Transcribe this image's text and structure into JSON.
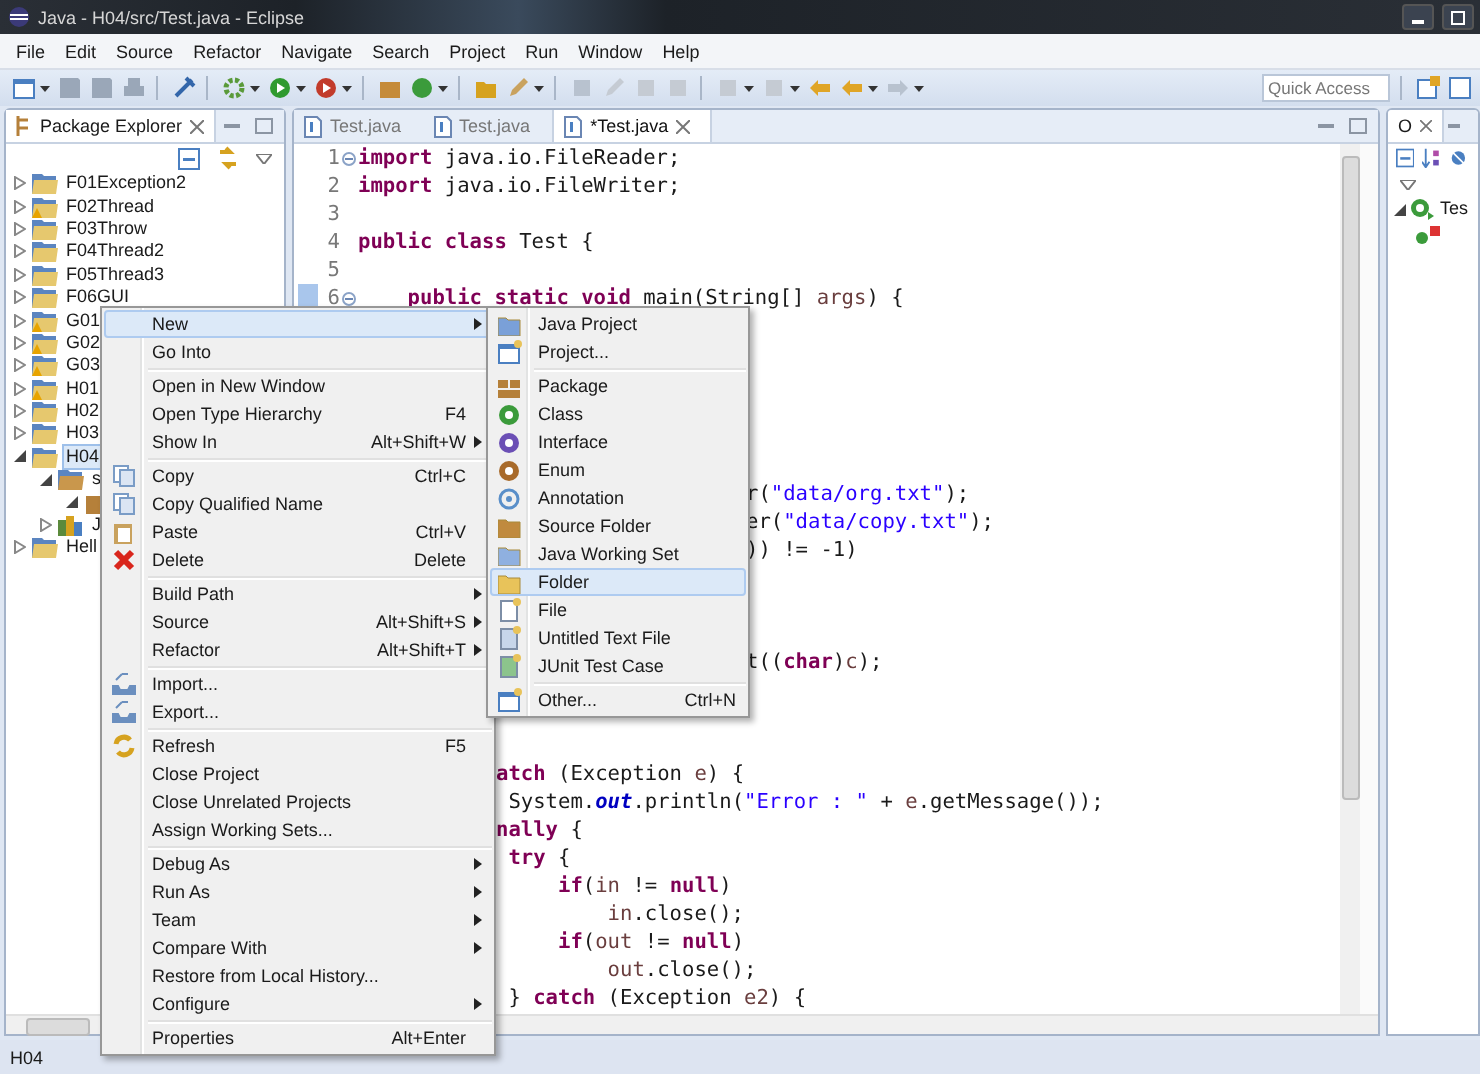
{
  "window": {
    "title": "Java - H04/src/Test.java - Eclipse"
  },
  "menu_bar": [
    "File",
    "Edit",
    "Source",
    "Refactor",
    "Navigate",
    "Search",
    "Project",
    "Run",
    "Window",
    "Help"
  ],
  "quick_access": {
    "placeholder": "Quick Access"
  },
  "package_explorer": {
    "title": "Package Explorer",
    "tree": [
      {
        "label": "F01Exception2",
        "kind": "project",
        "warning": false,
        "expanded": false,
        "selected": false
      },
      {
        "label": "F02Thread",
        "kind": "project",
        "warning": true,
        "expanded": false,
        "selected": false
      },
      {
        "label": "F03Throw",
        "kind": "project",
        "warning": false,
        "expanded": false,
        "selected": false
      },
      {
        "label": "F04Thread2",
        "kind": "project",
        "warning": false,
        "expanded": false,
        "selected": false
      },
      {
        "label": "F05Thread3",
        "kind": "project",
        "warning": false,
        "expanded": false,
        "selected": false
      },
      {
        "label": "F06GUI",
        "kind": "project",
        "warning": false,
        "expanded": false,
        "selected": false
      },
      {
        "label": "G01",
        "kind": "project",
        "warning": true,
        "expanded": false,
        "selected": false
      },
      {
        "label": "G02",
        "kind": "project",
        "warning": true,
        "expanded": false,
        "selected": false
      },
      {
        "label": "G03",
        "kind": "project",
        "warning": true,
        "expanded": false,
        "selected": false
      },
      {
        "label": "H01",
        "kind": "project",
        "warning": true,
        "expanded": false,
        "selected": false
      },
      {
        "label": "H02",
        "kind": "project",
        "warning": false,
        "expanded": false,
        "selected": false
      },
      {
        "label": "H03",
        "kind": "project",
        "warning": false,
        "expanded": false,
        "selected": false
      },
      {
        "label": "H04",
        "kind": "project",
        "warning": false,
        "expanded": true,
        "selected": true,
        "children": [
          {
            "label": "s",
            "kind": "source",
            "warning": false,
            "expanded": true,
            "selected": false,
            "children": [
              {
                "kind": "package",
                "warning": false,
                "expanded": true,
                "selected": false
              }
            ]
          },
          {
            "label": "J",
            "kind": "library",
            "warning": false,
            "expanded": false,
            "selected": false
          }
        ]
      },
      {
        "label": "Hell",
        "kind": "project",
        "warning": false,
        "expanded": false,
        "selected": false
      }
    ]
  },
  "editor": {
    "tabs": [
      {
        "label": "Test.java",
        "selected": false
      },
      {
        "label": "Test.java",
        "selected": false
      },
      {
        "label": "*Test.java",
        "selected": true
      }
    ],
    "lines": [
      {
        "kind": "numbered",
        "number": "1",
        "fold": true,
        "changed": false,
        "tokens": [
          {
            "text": "import",
            "kind": "keyword"
          },
          {
            "text": " java.io.FileReader;",
            "kind": "plain"
          }
        ]
      },
      {
        "kind": "numbered",
        "number": "2",
        "fold": false,
        "changed": false,
        "tokens": [
          {
            "text": "import",
            "kind": "keyword"
          },
          {
            "text": " java.io.FileWriter;",
            "kind": "plain"
          }
        ]
      },
      {
        "kind": "numbered",
        "number": "3",
        "fold": false,
        "changed": false
      },
      {
        "kind": "numbered",
        "number": "4",
        "fold": false,
        "changed": false,
        "tokens": [
          {
            "text": "public",
            "kind": "keyword"
          },
          {
            "text": " class",
            "kind": "keyword"
          },
          {
            "text": " Test {",
            "kind": "plain"
          }
        ]
      },
      {
        "kind": "numbered",
        "number": "5",
        "fold": false,
        "changed": false
      },
      {
        "kind": "numbered",
        "number": "6",
        "fold": true,
        "changed": true,
        "tokens": [
          {
            "text": "    public",
            "kind": "keyword"
          },
          {
            "text": " static",
            "kind": "keyword"
          },
          {
            "text": " void",
            "kind": "keyword"
          },
          {
            "text": " main(String[] ",
            "kind": "plain"
          },
          {
            "text": "args",
            "kind": "variable"
          },
          {
            "text": ") {",
            "kind": "plain"
          }
        ]
      },
      {
        "kind": "under-submenu",
        "tokens": [
          {
            "text": "r(",
            "kind": "plain"
          },
          {
            "text": "\"data/org.txt\"",
            "kind": "string"
          },
          {
            "text": ");",
            "kind": "plain"
          }
        ]
      },
      {
        "kind": "under-submenu",
        "tokens": [
          {
            "text": "er(",
            "kind": "plain"
          },
          {
            "text": "\"data/copy.txt\"",
            "kind": "string"
          },
          {
            "text": ");",
            "kind": "plain"
          }
        ]
      },
      {
        "kind": "under-submenu",
        "tokens": [
          {
            "text": ")) != -1)",
            "kind": "plain"
          }
        ]
      },
      {
        "kind": "under-submenu",
        "tokens": [
          {
            "text": "t((",
            "kind": "plain"
          },
          {
            "text": "char",
            "kind": "keyword"
          },
          {
            "text": ")",
            "kind": "plain"
          },
          {
            "text": "c",
            "kind": "variable"
          },
          {
            "text": ");",
            "kind": "plain"
          }
        ]
      },
      {
        "kind": "under-menu",
        "tokens": [
          {
            "text": "atch",
            "kind": "keyword"
          },
          {
            "text": " (Exception ",
            "kind": "plain"
          },
          {
            "text": "e",
            "kind": "variable"
          },
          {
            "text": ") {",
            "kind": "plain"
          }
        ]
      },
      {
        "kind": "under-menu",
        "tokens": [
          {
            "text": " System.",
            "kind": "plain"
          },
          {
            "text": "out",
            "kind": "field"
          },
          {
            "text": ".println(",
            "kind": "plain"
          },
          {
            "text": "\"Error : \"",
            "kind": "string"
          },
          {
            "text": " + ",
            "kind": "plain"
          },
          {
            "text": "e",
            "kind": "variable"
          },
          {
            "text": ".getMessage());",
            "kind": "plain"
          }
        ]
      },
      {
        "kind": "under-menu",
        "tokens": [
          {
            "text": "nally",
            "kind": "keyword"
          },
          {
            "text": " {",
            "kind": "plain"
          }
        ]
      },
      {
        "kind": "under-menu",
        "tokens": [
          {
            "text": " try",
            "kind": "keyword"
          },
          {
            "text": " {",
            "kind": "plain"
          }
        ]
      },
      {
        "kind": "under-menu",
        "tokens": [
          {
            "text": "     if",
            "kind": "keyword"
          },
          {
            "text": "(",
            "kind": "plain"
          },
          {
            "text": "in",
            "kind": "variable"
          },
          {
            "text": " != ",
            "kind": "plain"
          },
          {
            "text": "null",
            "kind": "keyword"
          },
          {
            "text": ")",
            "kind": "plain"
          }
        ]
      },
      {
        "kind": "under-menu",
        "tokens": [
          {
            "text": "         in",
            "kind": "variable"
          },
          {
            "text": ".close();",
            "kind": "plain"
          }
        ]
      },
      {
        "kind": "under-menu",
        "tokens": [
          {
            "text": "     if",
            "kind": "keyword"
          },
          {
            "text": "(",
            "kind": "plain"
          },
          {
            "text": "out",
            "kind": "variable"
          },
          {
            "text": " != ",
            "kind": "plain"
          },
          {
            "text": "null",
            "kind": "keyword"
          },
          {
            "text": ")",
            "kind": "plain"
          }
        ]
      },
      {
        "kind": "under-menu",
        "tokens": [
          {
            "text": "         out",
            "kind": "variable"
          },
          {
            "text": ".close();",
            "kind": "plain"
          }
        ]
      },
      {
        "kind": "under-menu",
        "tokens": [
          {
            "text": " } ",
            "kind": "plain"
          },
          {
            "text": "catch",
            "kind": "keyword"
          },
          {
            "text": " (Exception ",
            "kind": "plain"
          },
          {
            "text": "e2",
            "kind": "variable"
          },
          {
            "text": ") {",
            "kind": "plain"
          }
        ]
      }
    ]
  },
  "outline": {
    "title": "O",
    "tree": [
      {
        "label": "Tes",
        "kind": "class",
        "expanded": true
      }
    ]
  },
  "context_menu": [
    {
      "kind": "item",
      "label": "New",
      "submenu": true,
      "selected": true
    },
    {
      "kind": "item",
      "label": "Go Into",
      "submenu": false,
      "selected": false
    },
    {
      "kind": "separator"
    },
    {
      "kind": "item",
      "label": "Open in New Window",
      "submenu": false,
      "selected": false
    },
    {
      "kind": "item",
      "label": "Open Type Hierarchy",
      "shortcut": "F4",
      "submenu": false,
      "selected": false
    },
    {
      "kind": "item",
      "label": "Show In",
      "shortcut": "Alt+Shift+W",
      "submenu": true,
      "selected": false
    },
    {
      "kind": "separator"
    },
    {
      "kind": "copy",
      "label": "Copy",
      "shortcut": "Ctrl+C",
      "submenu": false,
      "selected": false
    },
    {
      "kind": "copy",
      "label": "Copy Qualified Name",
      "submenu": false,
      "selected": false
    },
    {
      "kind": "paste",
      "label": "Paste",
      "shortcut": "Ctrl+V",
      "submenu": false,
      "selected": false
    },
    {
      "kind": "delete",
      "label": "Delete",
      "shortcut": "Delete",
      "submenu": false,
      "selected": false
    },
    {
      "kind": "separator"
    },
    {
      "kind": "item",
      "label": "Build Path",
      "submenu": true,
      "selected": false
    },
    {
      "kind": "item",
      "label": "Source",
      "shortcut": "Alt+Shift+S",
      "submenu": true,
      "selected": false
    },
    {
      "kind": "item",
      "label": "Refactor",
      "shortcut": "Alt+Shift+T",
      "submenu": true,
      "selected": false
    },
    {
      "kind": "separator"
    },
    {
      "kind": "import",
      "label": "Import...",
      "submenu": false,
      "selected": false
    },
    {
      "kind": "export",
      "label": "Export...",
      "submenu": false,
      "selected": false
    },
    {
      "kind": "separator"
    },
    {
      "kind": "refresh",
      "label": "Refresh",
      "shortcut": "F5",
      "submenu": false,
      "selected": false
    },
    {
      "kind": "item",
      "label": "Close Project",
      "submenu": false,
      "selected": false
    },
    {
      "kind": "item",
      "label": "Close Unrelated Projects",
      "submenu": false,
      "selected": false
    },
    {
      "kind": "item",
      "label": "Assign Working Sets...",
      "submenu": false,
      "selected": false
    },
    {
      "kind": "separator"
    },
    {
      "kind": "item",
      "label": "Debug As",
      "submenu": true,
      "selected": false
    },
    {
      "kind": "item",
      "label": "Run As",
      "submenu": true,
      "selected": false
    },
    {
      "kind": "item",
      "label": "Team",
      "submenu": true,
      "selected": false
    },
    {
      "kind": "item",
      "label": "Compare With",
      "submenu": true,
      "selected": false
    },
    {
      "kind": "item",
      "label": "Restore from Local History...",
      "submenu": false,
      "selected": false
    },
    {
      "kind": "item",
      "label": "Configure",
      "submenu": true,
      "selected": false
    },
    {
      "kind": "separator"
    },
    {
      "kind": "item",
      "label": "Properties",
      "shortcut": "Alt+Enter",
      "submenu": false,
      "selected": false
    }
  ],
  "new_submenu": [
    {
      "kind": "java-project",
      "label": "Java Project",
      "selected": false
    },
    {
      "kind": "project",
      "label": "Project...",
      "selected": false
    },
    {
      "kind": "separator"
    },
    {
      "kind": "package",
      "label": "Package",
      "selected": false
    },
    {
      "kind": "class",
      "label": "Class",
      "selected": false
    },
    {
      "kind": "interface",
      "label": "Interface",
      "selected": false
    },
    {
      "kind": "enum",
      "label": "Enum",
      "selected": false
    },
    {
      "kind": "annotation",
      "label": "Annotation",
      "selected": false
    },
    {
      "kind": "source-folder",
      "label": "Source Folder",
      "selected": false
    },
    {
      "kind": "working-set",
      "label": "Java Working Set",
      "selected": false
    },
    {
      "kind": "folder",
      "label": "Folder",
      "selected": true
    },
    {
      "kind": "file",
      "label": "File",
      "selected": false
    },
    {
      "kind": "text-file",
      "label": "Untitled Text File",
      "selected": false
    },
    {
      "kind": "junit",
      "label": "JUnit Test Case",
      "selected": false
    },
    {
      "kind": "separator"
    },
    {
      "kind": "project",
      "label": "Other...",
      "shortcut": "Ctrl+N",
      "selected": false
    }
  ],
  "status_bar": {
    "text": "H04"
  }
}
